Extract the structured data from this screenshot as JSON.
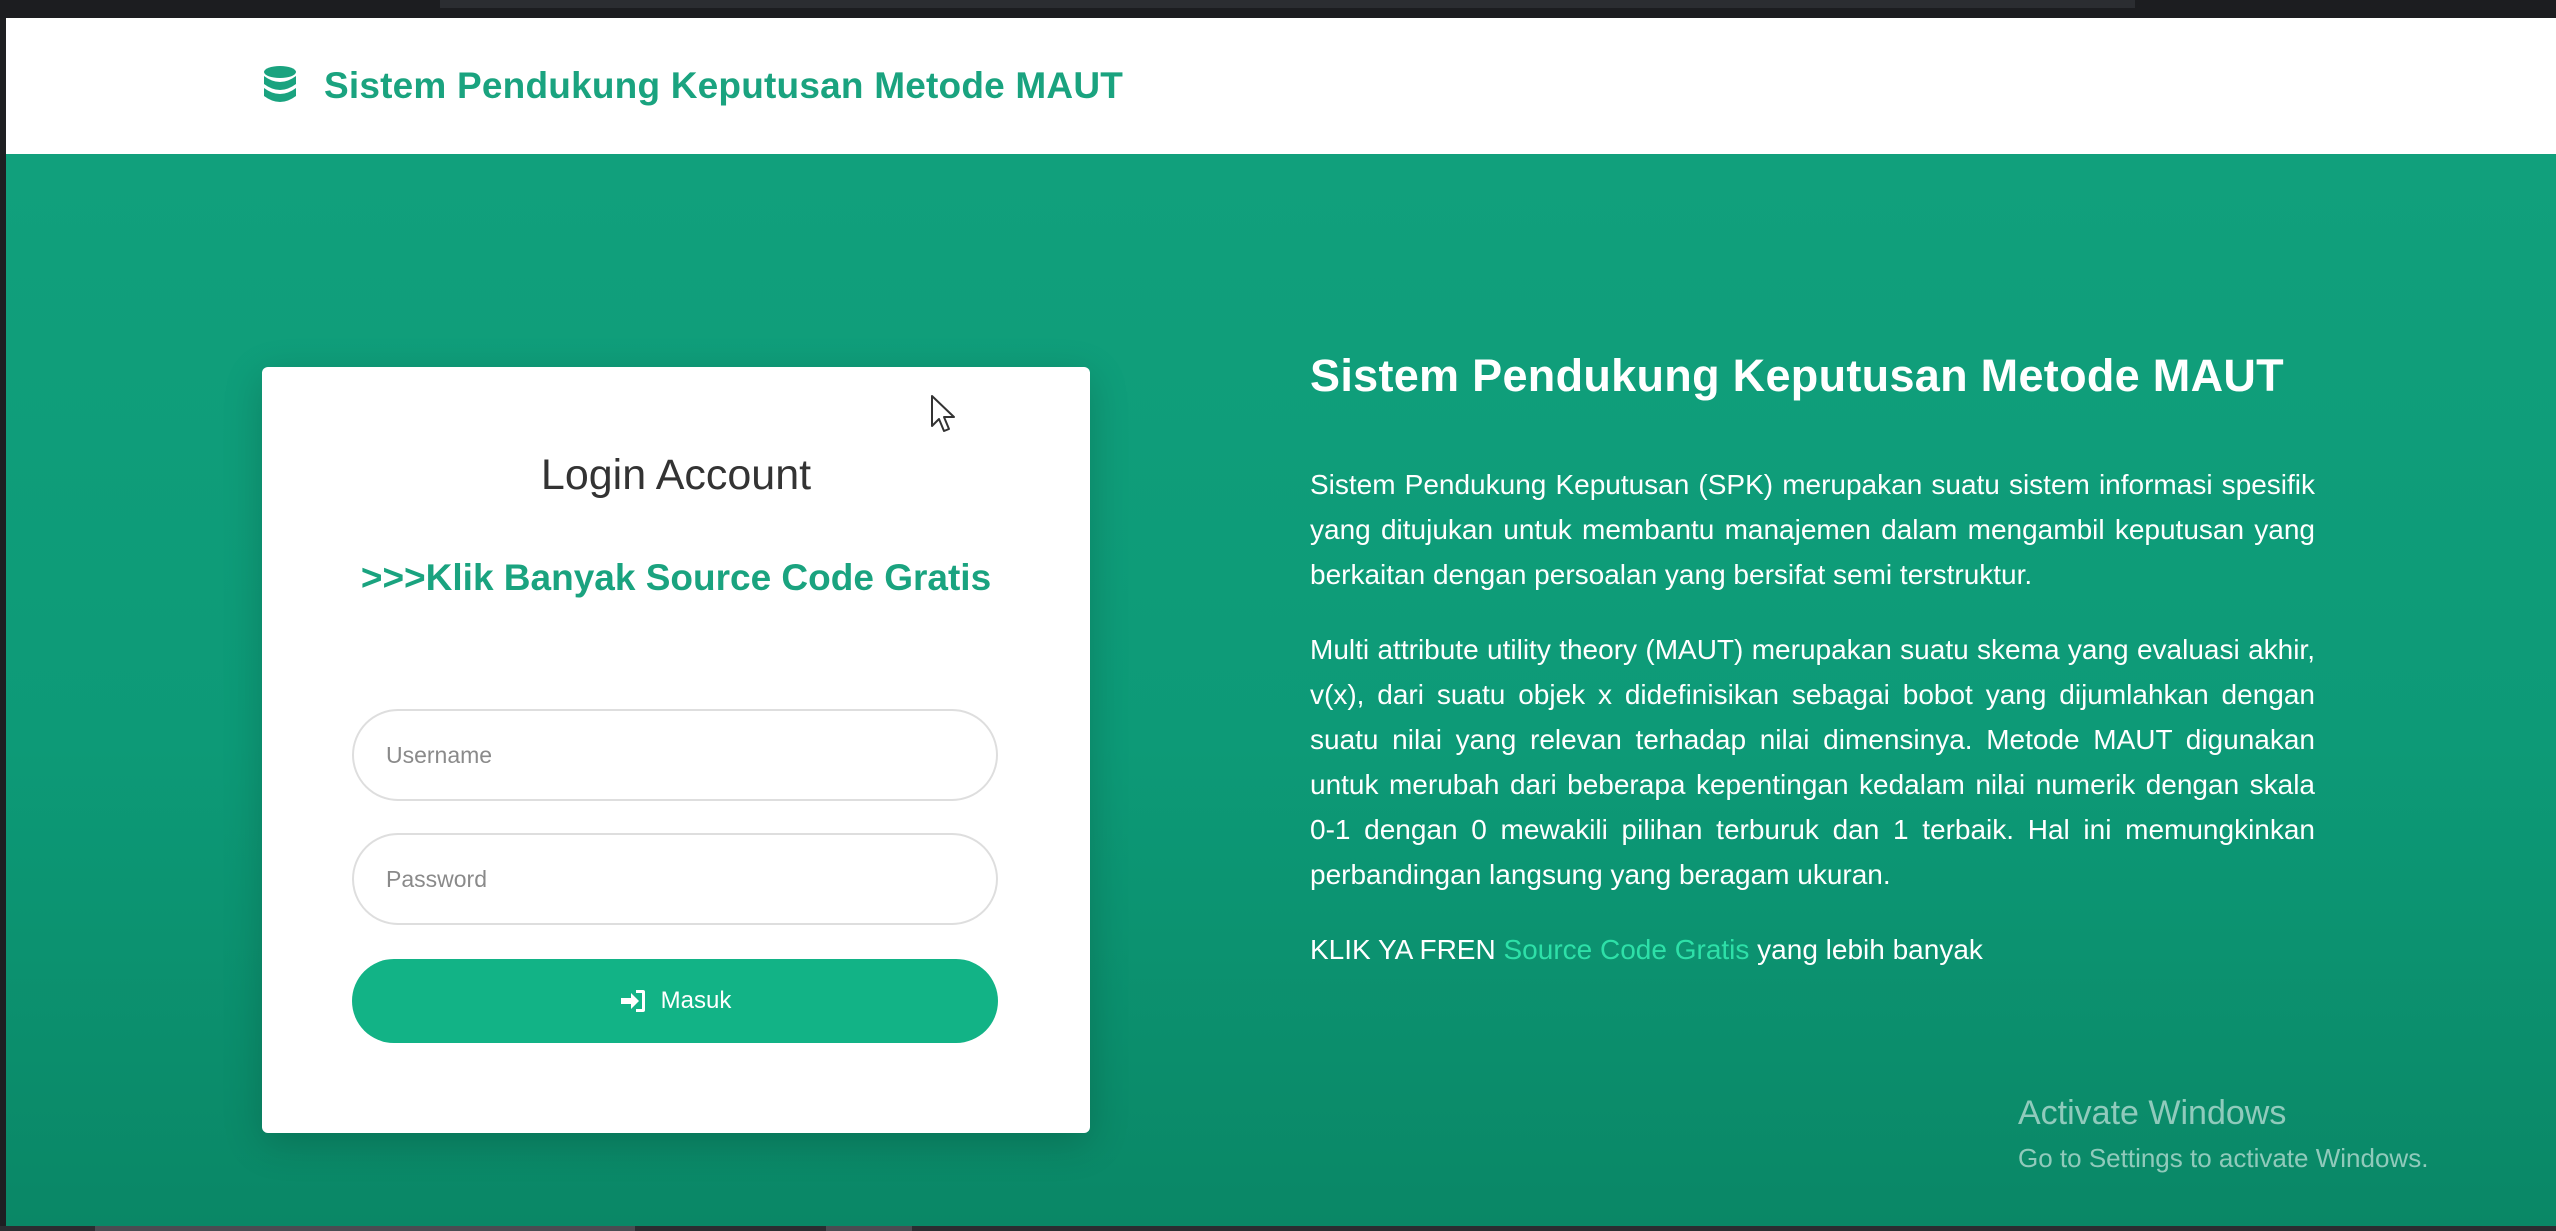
{
  "navbar": {
    "brand_icon": "database-icon",
    "brand_text": "Sistem Pendukung Keputusan Metode MAUT"
  },
  "login": {
    "title": "Login Account",
    "promo_link": ">>>Klik Banyak Source Code Gratis",
    "username_placeholder": "Username",
    "password_placeholder": "Password",
    "submit_icon": "sign-in-icon",
    "submit_label": "Masuk"
  },
  "info": {
    "title": "Sistem Pendukung Keputusan Metode MAUT",
    "paragraph1": "Sistem Pendukung Keputusan (SPK) merupakan suatu sistem informasi spesifik yang ditujukan untuk membantu manajemen dalam mengambil keputusan yang berkaitan dengan persoalan yang bersifat semi terstruktur.",
    "paragraph2": "Multi attribute utility theory (MAUT) merupakan suatu skema yang evaluasi akhir, v(x), dari suatu objek x didefinisikan sebagai bobot yang dijumlahkan dengan suatu nilai yang relevan terhadap nilai dimensinya. Metode MAUT digunakan untuk merubah dari beberapa kepentingan kedalam nilai numerik dengan skala 0-1 dengan 0 mewakili pilihan terburuk dan 1 terbaik. Hal ini memungkinkan perbandingan langsung yang beragam ukuran.",
    "cta_prefix": "KLIK YA FREN",
    "cta_link": "Source Code Gratis",
    "cta_suffix": "yang lebih banyak"
  },
  "watermark": {
    "title": "Activate Windows",
    "subtitle": "Go to Settings to activate Windows."
  },
  "colors": {
    "accent": "#1aa37f",
    "button": "#12b386",
    "hero_bg": "#0d9a77",
    "link": "#2ee0a8"
  }
}
